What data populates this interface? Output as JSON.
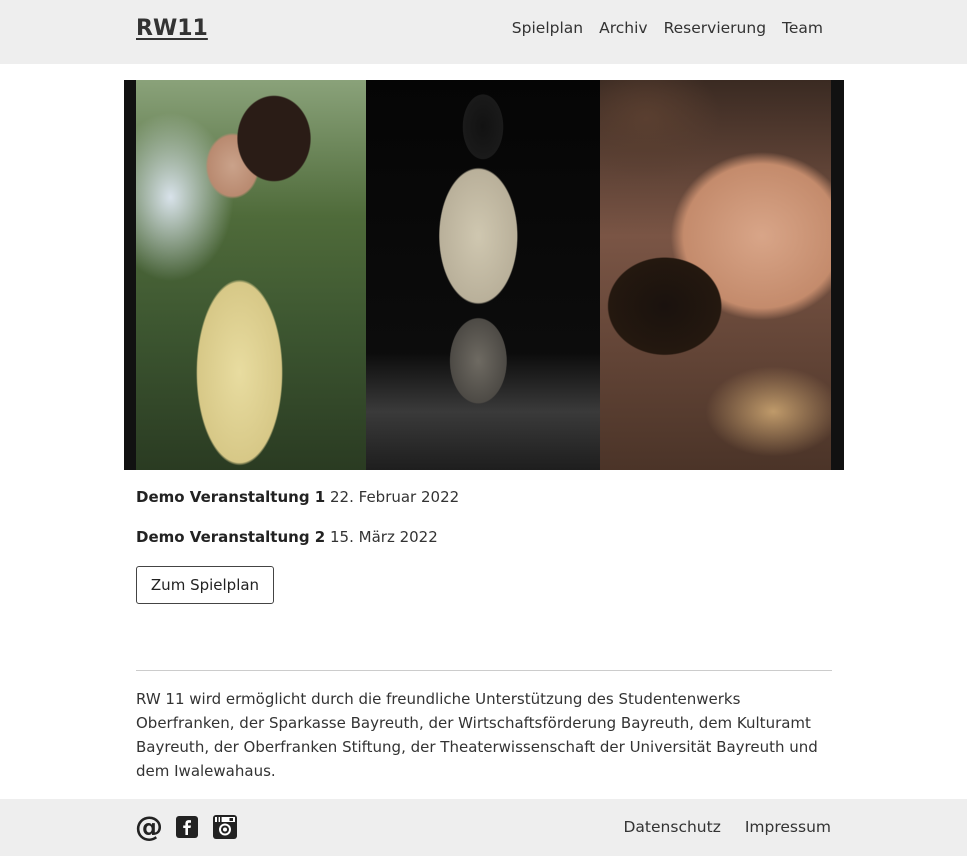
{
  "navbar": {
    "brand": "RW11",
    "links": [
      "Spielplan",
      "Archiv",
      "Reservierung",
      "Team"
    ]
  },
  "events": [
    {
      "title": "Demo Veranstaltung 1",
      "date": "22. Februar 2022"
    },
    {
      "title": "Demo Veranstaltung 2",
      "date": "15. März 2022"
    }
  ],
  "button_label": "Zum Spielplan",
  "sponsor_text": "RW 11 wird ermöglicht durch die freundliche Unterstützung des Studentenwerks Oberfranken, der Sparkasse Bayreuth, der Wirtschaftsförderung Bayreuth, dem Kulturamt Bayreuth, der Oberfranken Stiftung, der Theaterwissenschaft der Universität Bayreuth und dem Iwalewahaus.",
  "footer": {
    "icons": [
      "email-icon",
      "facebook-icon",
      "instagram-icon"
    ],
    "links": [
      "Datenschutz",
      "Impressum"
    ]
  },
  "colors": {
    "nav_background": "#eeeeee",
    "text": "#222222"
  }
}
